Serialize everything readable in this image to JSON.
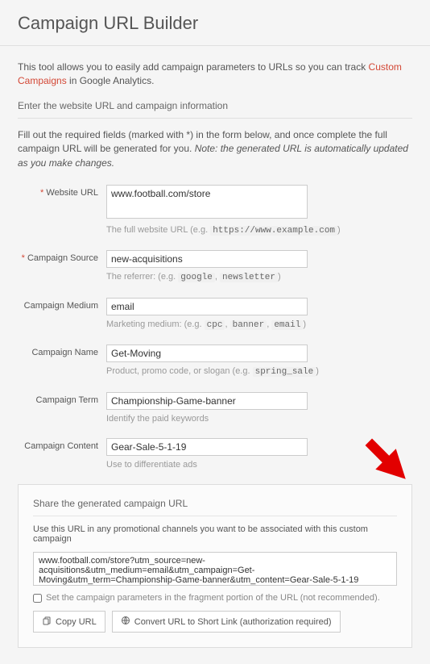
{
  "title": "Campaign URL Builder",
  "intro_prefix": "This tool allows you to easily add campaign parameters to URLs so you can track ",
  "intro_link": "Custom Campaigns",
  "intro_suffix": " in Google Analytics.",
  "section_heading": "Enter the website URL and campaign information",
  "instructions_text": "Fill out the required fields (marked with *) in the form below, and once complete the full campaign URL will be generated for you. ",
  "instructions_note": "Note: the generated URL is automatically updated as you make changes.",
  "required_marker": "*",
  "fields": {
    "website_url": {
      "label": "Website URL",
      "value": "www.football.com/store",
      "hint_prefix": "The full website URL (e.g. ",
      "hint_code": "https://www.example.com",
      "hint_suffix": ")"
    },
    "campaign_source": {
      "label": "Campaign Source",
      "value": "new-acquisitions",
      "hint_prefix": "The referrer: (e.g. ",
      "hint_code1": "google",
      "hint_sep": ", ",
      "hint_code2": "newsletter",
      "hint_suffix": ")"
    },
    "campaign_medium": {
      "label": "Campaign Medium",
      "value": "email",
      "hint_prefix": "Marketing medium: (e.g. ",
      "hint_code1": "cpc",
      "hint_sep": ", ",
      "hint_code2": "banner",
      "hint_code3": "email",
      "hint_suffix": ")"
    },
    "campaign_name": {
      "label": "Campaign Name",
      "value": "Get-Moving",
      "hint_prefix": "Product, promo code, or slogan (e.g. ",
      "hint_code": "spring_sale",
      "hint_suffix": ")"
    },
    "campaign_term": {
      "label": "Campaign Term",
      "value": "Championship-Game-banner",
      "hint": "Identify the paid keywords"
    },
    "campaign_content": {
      "label": "Campaign Content",
      "value": "Gear-Sale-5-1-19",
      "hint": "Use to differentiate ads"
    }
  },
  "share": {
    "heading": "Share the generated campaign URL",
    "description": "Use this URL in any promotional channels you want to be associated with this custom campaign",
    "generated_url": "www.football.com/store?utm_source=new-acquisitions&utm_medium=email&utm_campaign=Get-Moving&utm_term=Championship-Game-banner&utm_content=Gear-Sale-5-1-19",
    "fragment_label": "Set the campaign parameters in the fragment portion of the URL (not recommended).",
    "copy_button": "Copy URL",
    "convert_button": "Convert URL to Short Link (authorization required)"
  }
}
